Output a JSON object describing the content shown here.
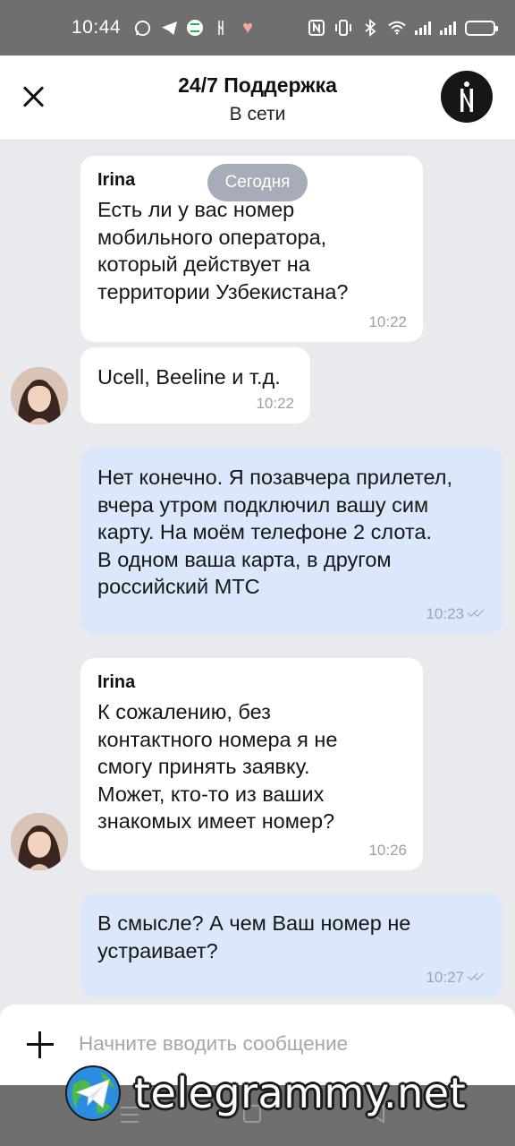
{
  "status_bar": {
    "time": "10:44",
    "icons": [
      "whatsapp-icon",
      "telegram-icon",
      "spotify-icon",
      "signal-icon",
      "heart-icon",
      "nfc-icon",
      "vibrate-icon",
      "bluetooth-icon",
      "wifi-icon",
      "cell-signal-icon",
      "battery-icon"
    ]
  },
  "header": {
    "title": "24/7 Поддержка",
    "subtitle": "В сети"
  },
  "chat": {
    "date_chip": "Сегодня",
    "messages": [
      {
        "direction": "in",
        "sender": "Irina",
        "text": "Есть ли у вас номер\nмобильного оператора,\nкоторый действует на\nтерритории Узбекистана?",
        "time": "10:22"
      },
      {
        "direction": "in",
        "sender": "",
        "text": "Ucell, Beeline и т.д.",
        "time": "10:22"
      },
      {
        "direction": "out",
        "text": "Нет конечно. Я позавчера прилетел,\nвчера утром подключил вашу сим\nкарту. На моём телефоне 2 слота.\nВ одном ваша карта, в другом\nроссийский МТС",
        "time": "10:23",
        "read": true
      },
      {
        "direction": "in",
        "sender": "Irina",
        "text": "К сожалению, без\nконтактного номера я не\nсмогу принять заявку.\nМожет, кто-то из ваших\nзнакомых имеет номер?",
        "time": "10:26"
      },
      {
        "direction": "out",
        "text": "В смысле? А чем Ваш номер не\nустраивает?",
        "time": "10:27",
        "read": true
      }
    ]
  },
  "input": {
    "placeholder": "Начните вводить сообщение"
  },
  "watermark": {
    "text": "telegrammy.net"
  },
  "colors": {
    "incoming_bubble": "#ffffff",
    "outgoing_bubble": "#dbe8fb",
    "chat_background": "#e9eaee",
    "date_chip": "#a6adb8",
    "system_bars": "#6f6f6f"
  }
}
